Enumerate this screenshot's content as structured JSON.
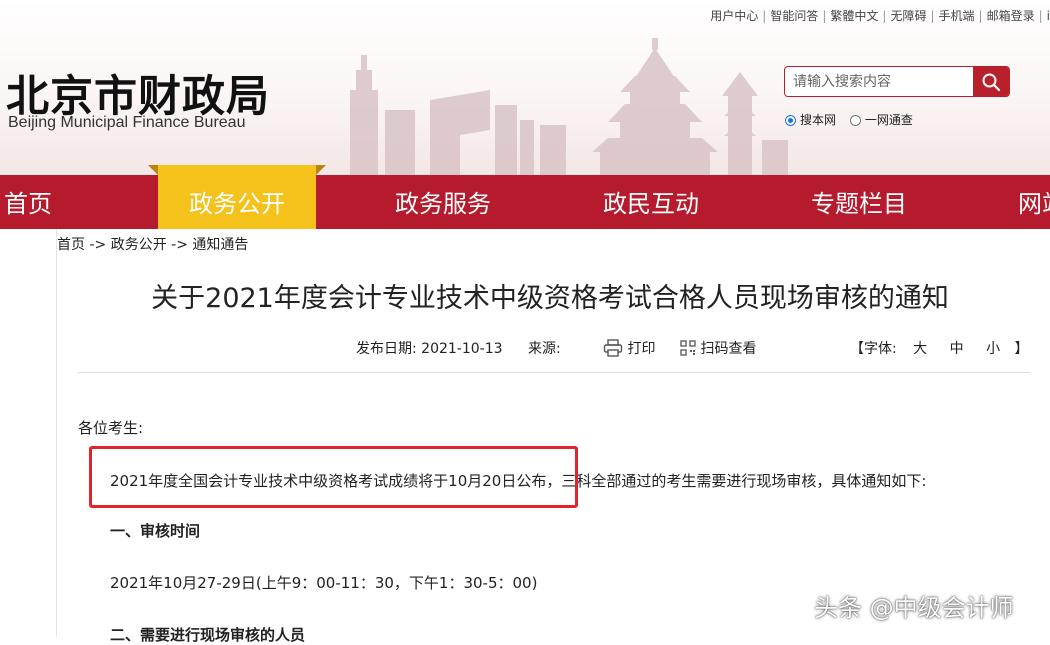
{
  "top_links": [
    "用户中心",
    "智能问答",
    "繁體中文",
    "无障碍",
    "手机端",
    "邮箱登录",
    "i"
  ],
  "logo": {
    "cn": "北京市财政局",
    "en": "Beijing Municipal Finance Bureau"
  },
  "search": {
    "placeholder": "请输入搜索内容",
    "icon": "search-icon",
    "scope_options": [
      "搜本网",
      "一网通查"
    ],
    "scope_selected": "搜本网"
  },
  "nav": {
    "items": [
      "首页",
      "政务公开",
      "政务服务",
      "政民互动",
      "专题栏目",
      "网站"
    ],
    "active": "政务公开"
  },
  "breadcrumb": {
    "items": [
      "首页",
      "政务公开",
      "通知通告"
    ],
    "separator": "->"
  },
  "article": {
    "title": "关于2021年度会计专业技术中级资格考试合格人员现场审核的通知",
    "meta": {
      "date_label": "发布日期:",
      "date": "2021-10-13",
      "source_label": "来源:",
      "print_label": "打印",
      "qr_label": "扫码查看",
      "font_label": "【字体:",
      "font_sizes": [
        "大",
        "中",
        "小"
      ],
      "font_end": "】"
    },
    "greeting": "各位考生:",
    "para1_highlighted": "2021年度全国会计专业技术中级资格考试成绩将于10月20日公布，",
    "para1_rest": "三科全部通过的考生需要进行现场审核，具体通知如下:",
    "section1_heading": "一、审核时间",
    "section1_text": "2021年10月27-29日(上午9：00-11：30，下午1：30-5：00)",
    "section2_heading": "二、需要进行现场审核的人员"
  },
  "watermark": "头条 @中级会计师",
  "colors": {
    "nav_red": "#b51b2d",
    "active_yellow": "#f4c21a",
    "highlight_red": "#e0242a"
  }
}
